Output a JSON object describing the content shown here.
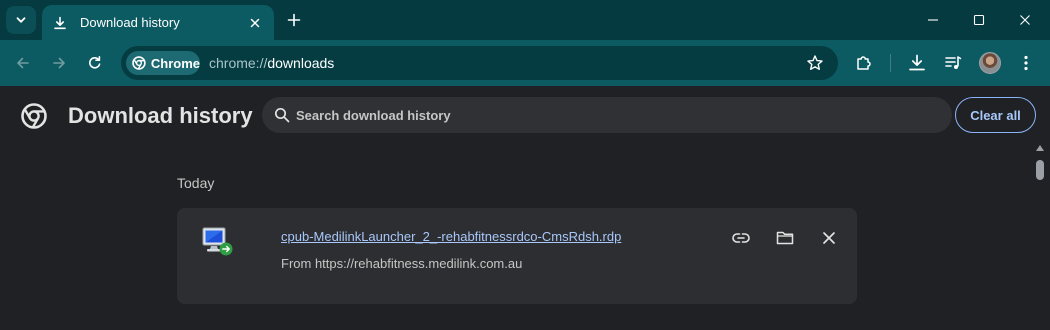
{
  "colors": {
    "tabstrip_bg": "#053a40",
    "toolbar_bg": "#0c5a62",
    "page_bg": "#202124",
    "card_bg": "#2d2e31",
    "link": "#a8c7fa",
    "accent_border": "#8ab4f8"
  },
  "tabstrip": {
    "tab_search_icon": "chevron-down-icon",
    "tab": {
      "title": "Download history",
      "favicon": "download-icon",
      "close_icon": "close-icon"
    },
    "new_tab_icon": "plus-icon",
    "window_controls": [
      "minimize-icon",
      "maximize-icon",
      "close-icon"
    ]
  },
  "toolbar": {
    "back_icon": "arrow-left-icon",
    "forward_icon": "arrow-right-icon",
    "reload_icon": "reload-icon",
    "omnibox": {
      "chip_label": "Chrome",
      "url_scheme": "chrome://",
      "url_host": "downloads",
      "bookmark_icon": "star-icon"
    },
    "extensions_icon": "puzzle-icon",
    "downloads_icon": "download-icon",
    "media_icon": "media-playlist-icon",
    "menu_icon": "more-vertical-icon"
  },
  "page": {
    "title": "Download history",
    "search": {
      "placeholder": "Search download history",
      "value": ""
    },
    "clear_all_label": "Clear all"
  },
  "downloads": {
    "groups": [
      {
        "date": "Today",
        "items": [
          {
            "file_name": "cpub-MedilinkLauncher_2_-rehabfitnessrdco-CmsRdsh.rdp",
            "from_text": "From https://rehabfitness.medilink.com.au",
            "file_icon": "remote-desktop-file-icon",
            "actions": [
              "link-icon",
              "folder-icon",
              "close-icon"
            ]
          }
        ]
      }
    ]
  }
}
